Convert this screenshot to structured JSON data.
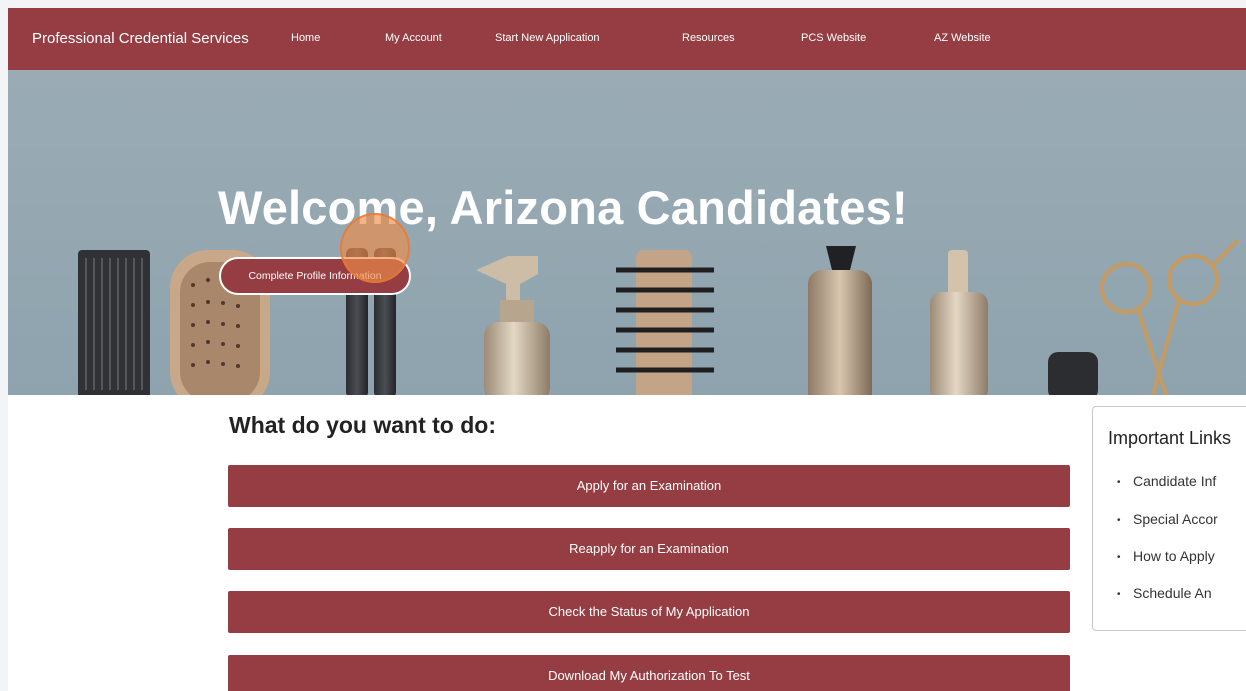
{
  "nav": {
    "brand": "Professional Credential Services",
    "links": [
      "Home",
      "My Account",
      "Start New Application",
      "Resources",
      "PCS Website",
      "AZ Website"
    ]
  },
  "hero": {
    "title": "Welcome, Arizona Candidates!",
    "button_label": "Complete Profile Information"
  },
  "main": {
    "heading": "What do you want to do:",
    "actions": [
      "Apply for an Examination",
      "Reapply for an Examination",
      "Check the Status of My Application",
      "Download My Authorization To Test"
    ]
  },
  "sidebar": {
    "title": "Important Links",
    "links": [
      "Candidate Inf",
      "Special Accor",
      "How to Apply",
      "Schedule An"
    ]
  },
  "colors": {
    "brand": "#953d42",
    "hero_background": "#9aabb4",
    "click_indicator": "#ee8c48"
  }
}
